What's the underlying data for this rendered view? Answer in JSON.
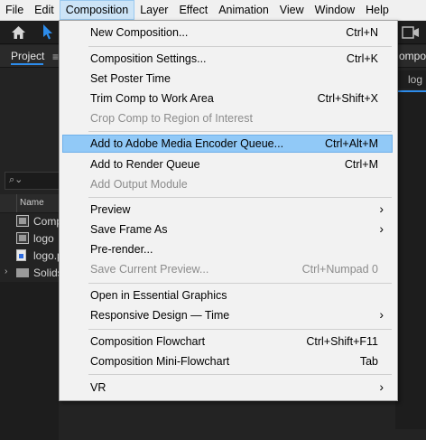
{
  "menubar": [
    "File",
    "Edit",
    "Composition",
    "Layer",
    "Effect",
    "Animation",
    "View",
    "Window",
    "Help"
  ],
  "active_menu": "Composition",
  "panel": {
    "title": "Project",
    "menu_icon": "≡",
    "column_name": "Name",
    "search_icon": "⌕⌄"
  },
  "right_panel": {
    "tab": "omposi",
    "subtab": "log"
  },
  "project_items": [
    {
      "label": "Compo",
      "icon": "composition-icon"
    },
    {
      "label": "logo",
      "icon": "composition-icon"
    },
    {
      "label": "logo.p",
      "icon": "image-file-icon"
    },
    {
      "label": "Solids",
      "icon": "folder-icon"
    }
  ],
  "menu_items": [
    {
      "label": "New Composition...",
      "shortcut": "Ctrl+N",
      "disabled": false
    },
    {
      "label": "Composition Settings...",
      "shortcut": "Ctrl+K",
      "disabled": false
    },
    {
      "label": "Set Poster Time",
      "shortcut": "",
      "disabled": false
    },
    {
      "label": "Trim Comp to Work Area",
      "shortcut": "Ctrl+Shift+X",
      "disabled": false
    },
    {
      "label": "Crop Comp to Region of Interest",
      "shortcut": "",
      "disabled": true
    },
    {
      "label": "Add to Adobe Media Encoder Queue...",
      "shortcut": "Ctrl+Alt+M",
      "disabled": false,
      "highlighted": true
    },
    {
      "label": "Add to Render Queue",
      "shortcut": "Ctrl+M",
      "disabled": false
    },
    {
      "label": "Add Output Module",
      "shortcut": "",
      "disabled": true
    },
    {
      "label": "Preview",
      "shortcut": "",
      "disabled": false,
      "submenu": true
    },
    {
      "label": "Save Frame As",
      "shortcut": "",
      "disabled": false,
      "submenu": true
    },
    {
      "label": "Pre-render...",
      "shortcut": "",
      "disabled": false
    },
    {
      "label": "Save Current Preview...",
      "shortcut": "Ctrl+Numpad 0",
      "disabled": true
    },
    {
      "label": "Open in Essential Graphics",
      "shortcut": "",
      "disabled": false
    },
    {
      "label": "Responsive Design — Time",
      "shortcut": "",
      "disabled": false,
      "submenu": true
    },
    {
      "label": "Composition Flowchart",
      "shortcut": "Ctrl+Shift+F11",
      "disabled": false
    },
    {
      "label": "Composition Mini-Flowchart",
      "shortcut": "Tab",
      "disabled": false
    },
    {
      "label": "VR",
      "shortcut": "",
      "disabled": false,
      "submenu": true
    }
  ],
  "colors": {
    "highlight": "#91c9f7",
    "menu_bg": "#f2f2f2",
    "app_bg": "#232323",
    "accent": "#2d8ceb"
  }
}
